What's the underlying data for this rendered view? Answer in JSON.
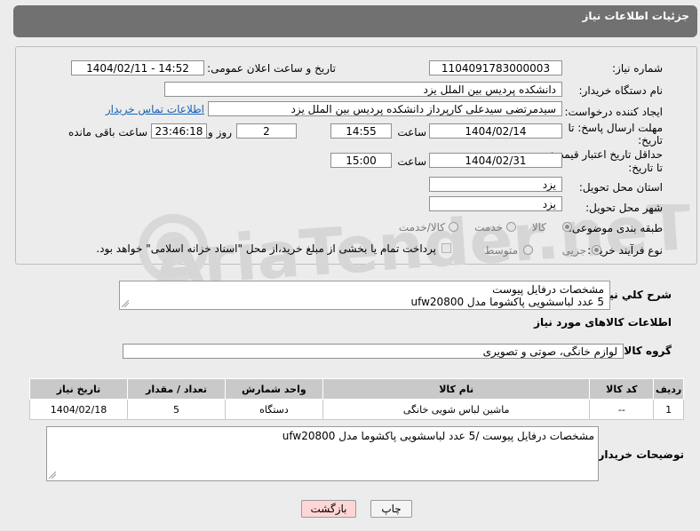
{
  "header": {
    "title": "جزئیات اطلاعات نیاز"
  },
  "form": {
    "need_number": {
      "label": "شماره نیاز:",
      "value": "1104091783000003"
    },
    "announce_datetime": {
      "label": "تاریخ و ساعت اعلان عمومی:",
      "value": "1404/02/11 - 14:52"
    },
    "buyer_org": {
      "label": "نام دستگاه خریدار:",
      "value": "دانشکده پردیس بین الملل یزد"
    },
    "requester": {
      "label": "ایجاد کننده درخواست:",
      "value": "سیدمرتضی سیدعلی کارپرداز دانشکده پردیس بین الملل یزد",
      "contact_link": "اطلاعات تماس خریدار"
    },
    "reply_deadline": {
      "label_line1": "مهلت ارسال پاسخ: تا",
      "label_line2": "تاریخ:",
      "date": "1404/02/14",
      "time_label": "ساعت",
      "time": "14:55",
      "days": "2",
      "days_label": "روز و",
      "remaining": "23:46:18",
      "remaining_label": "ساعت باقی مانده"
    },
    "price_validity": {
      "label_line1": "حداقل تاریخ اعتبار قیمت:",
      "label_line2": "تا تاریخ:",
      "date": "1404/02/31",
      "time_label": "ساعت",
      "time": "15:00"
    },
    "province": {
      "label": "استان محل تحویل:",
      "value": "یزد"
    },
    "city": {
      "label": "شهر محل تحویل:",
      "value": "یزد"
    },
    "category": {
      "label": "طبقه بندی موضوعی:",
      "options": [
        "کالا",
        "خدمت",
        "کالا/خدمت"
      ],
      "selected": "کالا"
    },
    "process_type": {
      "label": "نوع فرآیند خرید :",
      "options": [
        "جزیی",
        "متوسط"
      ],
      "selected": "جزیی",
      "note": "پرداخت تمام یا بخشی از مبلغ خرید،از محل \"اسناد خزانه اسلامی\" خواهد بود."
    }
  },
  "description": {
    "label": "شرح کلي نياز:",
    "line1": "مشخصات درفایل پیوست",
    "line2": "5 عدد لباسشویی پاکشوما مدل ufw20800"
  },
  "goods_info": {
    "title": "اطلاعات کالاهای مورد نیاز"
  },
  "goods_group": {
    "label": "گروه کالا:",
    "value": "لوازم خانگی، صوتی و تصویری"
  },
  "items_table": {
    "headers": [
      "ردیف",
      "کد کالا",
      "نام کالا",
      "واحد شمارش",
      "تعداد / مقدار",
      "تاریخ نیاز"
    ],
    "rows": [
      {
        "row": "1",
        "code": "--",
        "name": "ماشین لباس شویی خانگی",
        "unit": "دستگاه",
        "qty": "5",
        "date": "1404/02/18"
      }
    ]
  },
  "buyer_notes": {
    "label": "توضیحات خریدار:",
    "value": "مشخصات درفایل پیوست /5 عدد لباسشویی پاکشوما مدل ufw20800"
  },
  "buttons": {
    "print": "چاپ",
    "back": "بازگشت"
  },
  "watermark": {
    "text": "AriaTender.neT"
  },
  "colors": {
    "header_bg": "#717171",
    "link": "#1763b4",
    "back_button": "#ffd6d6",
    "table_header": "#c9c9c9"
  }
}
